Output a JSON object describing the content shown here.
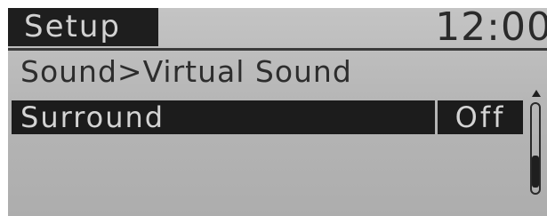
{
  "header": {
    "title": "Setup",
    "clock": "12:00"
  },
  "breadcrumb": "Sound>Virtual Sound",
  "menu": {
    "items": [
      {
        "label": "Surround",
        "value": "Off",
        "selected": true
      }
    ]
  },
  "colors": {
    "screen_background": "#b9b9b9",
    "highlight": "#1c1c1c",
    "highlight_text": "#d4d4d4"
  }
}
